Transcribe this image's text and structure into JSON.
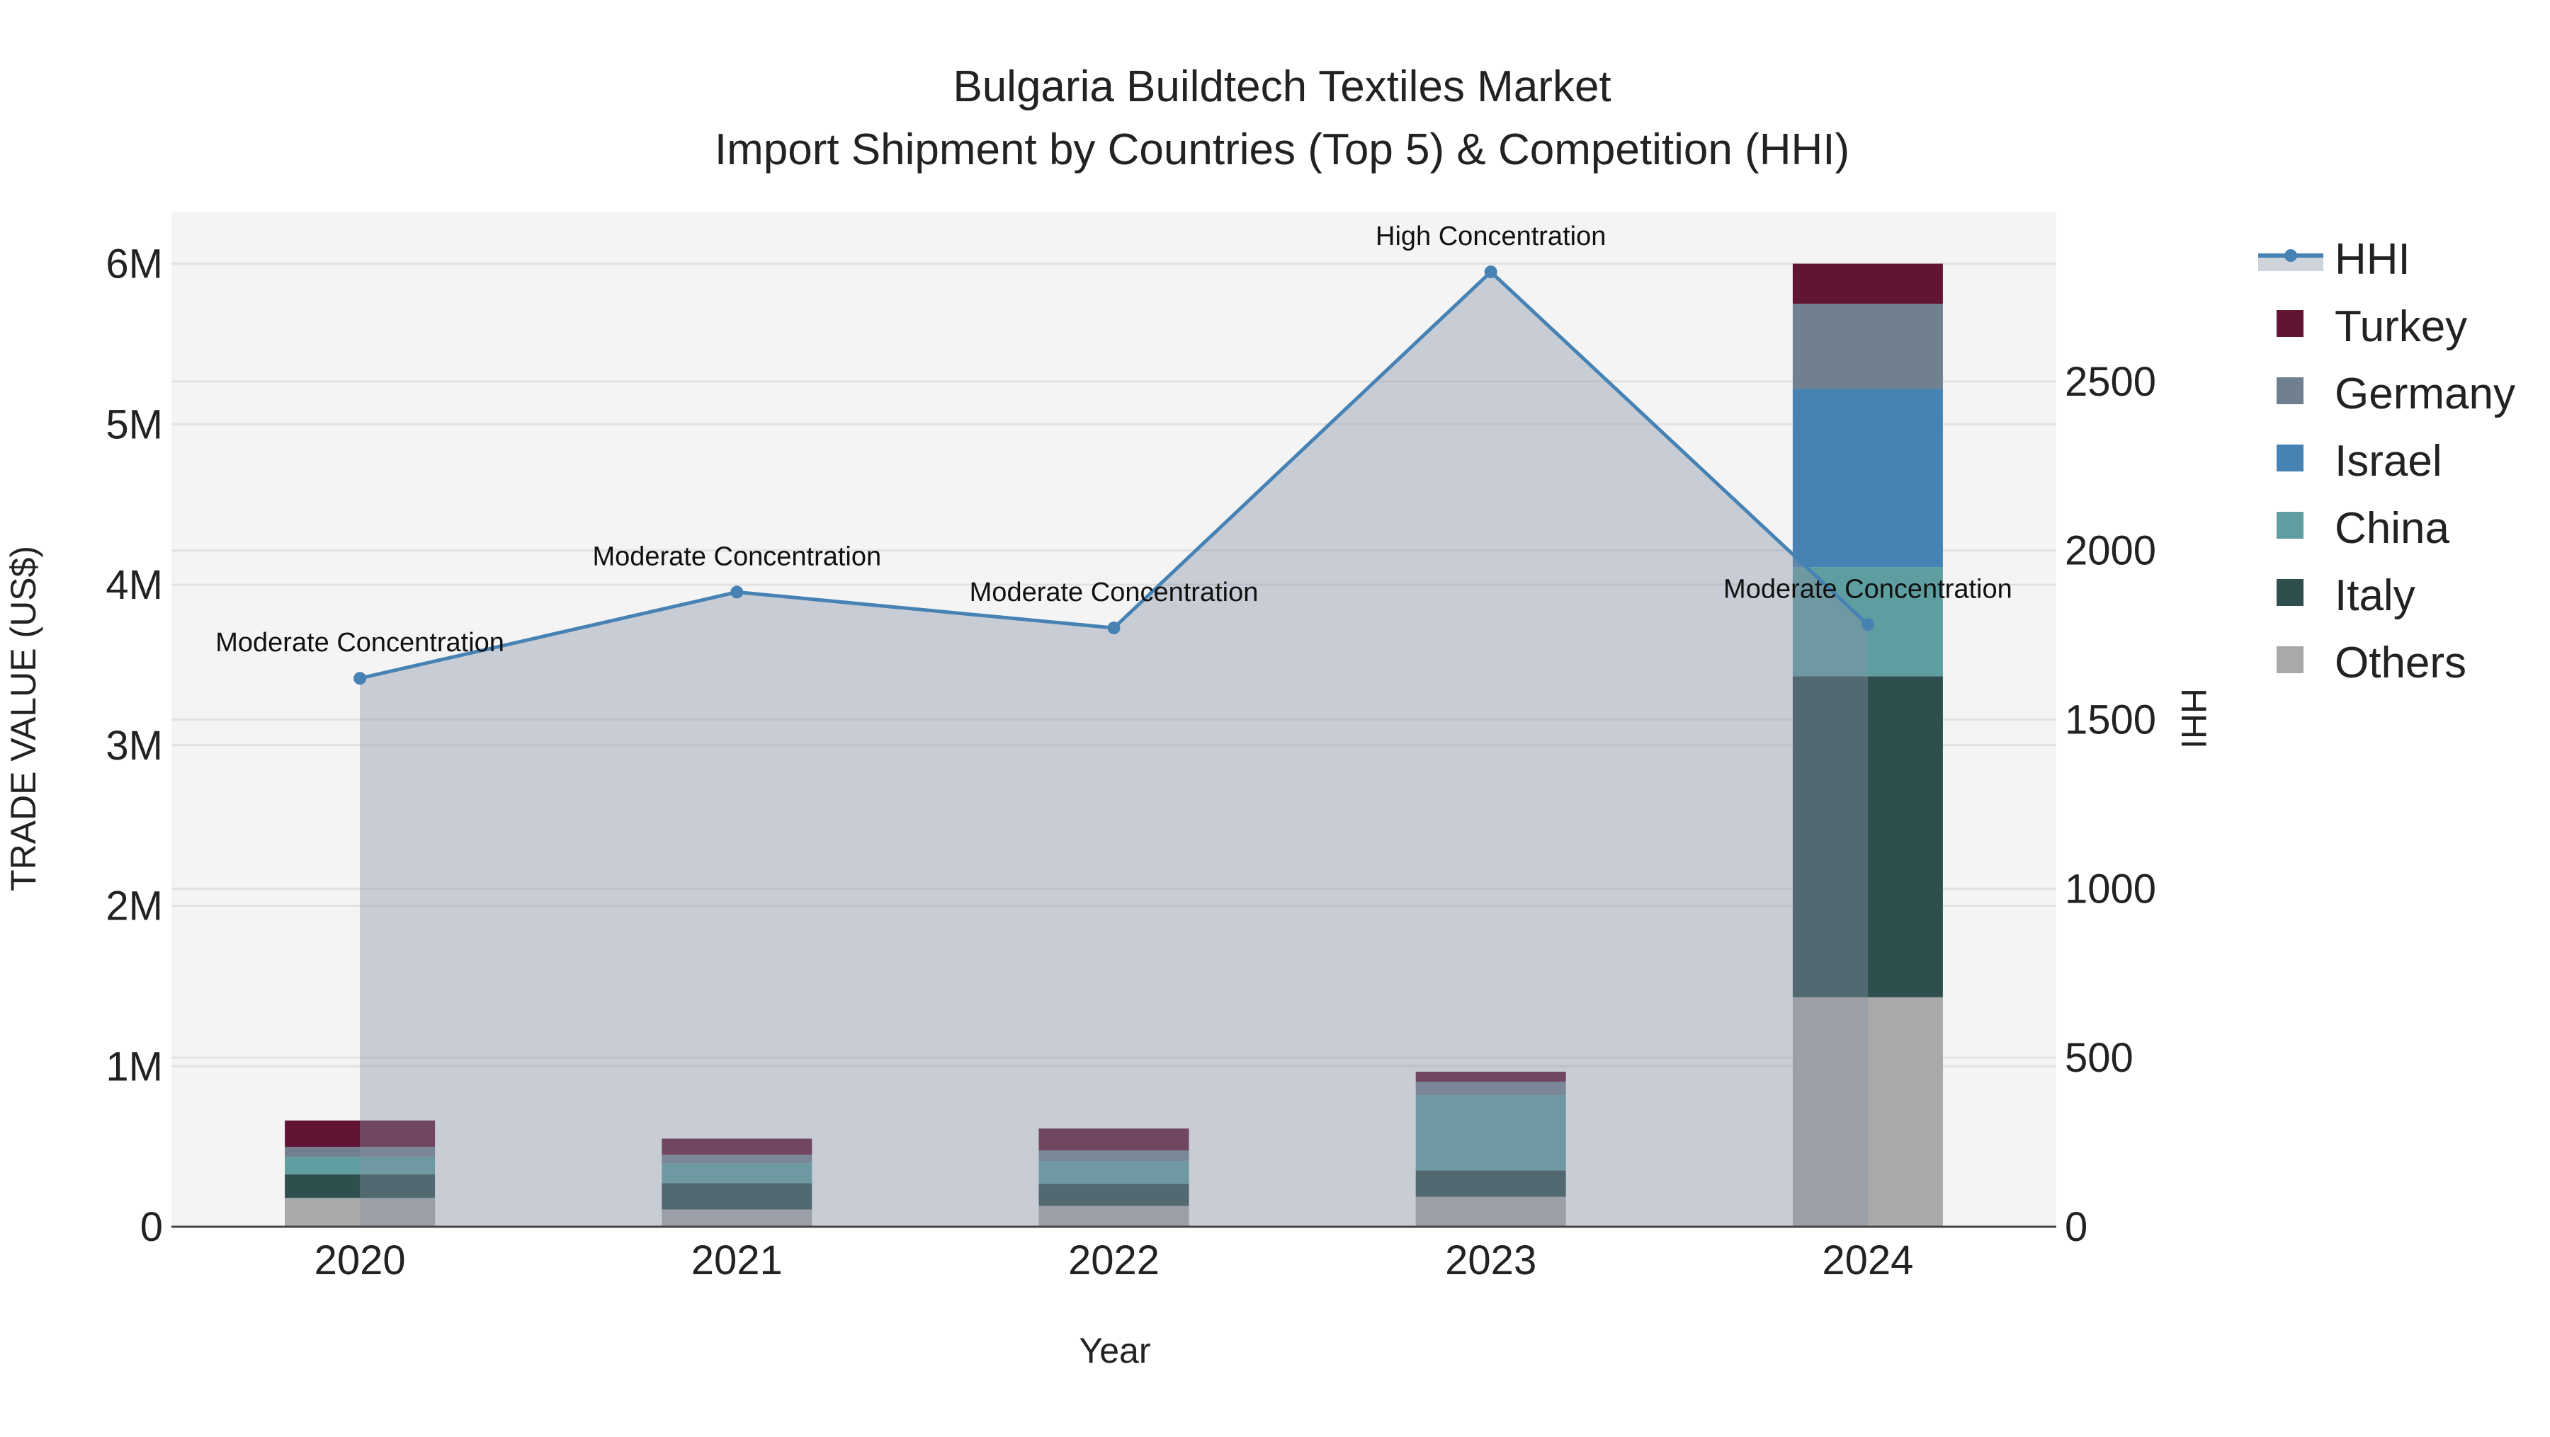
{
  "chart_data": {
    "type": "bar",
    "stacked": true,
    "title": "Bulgaria Buildtech Textiles Market",
    "subtitle": "Import Shipment by Countries (Top 5) & Competition (HHI)",
    "xlabel": "Year",
    "ylabel": "TRADE VALUE (US$)",
    "y2label": "HHI",
    "categories": [
      "2020",
      "2021",
      "2022",
      "2023",
      "2024"
    ],
    "ylim": [
      0,
      6320000
    ],
    "y2lim": [
      0,
      3000
    ],
    "yticks": [
      0,
      1000000,
      2000000,
      3000000,
      4000000,
      5000000,
      6000000
    ],
    "ytick_labels": [
      "0",
      "1M",
      "2M",
      "3M",
      "4M",
      "5M",
      "6M"
    ],
    "y2ticks": [
      0,
      500,
      1000,
      1500,
      2000,
      2500
    ],
    "y2tick_labels": [
      "0",
      "500",
      "1000",
      "1500",
      "2000",
      "2500"
    ],
    "grid": true,
    "legend_position": "right",
    "series": [
      {
        "name": "Others",
        "color": "#a9a9a9",
        "values": [
          180000,
          108000,
          130000,
          187000,
          1430000
        ]
      },
      {
        "name": "Italy",
        "color": "#2f4f4f",
        "values": [
          146000,
          164000,
          137000,
          164000,
          2000000
        ]
      },
      {
        "name": "China",
        "color": "#5f9ea0",
        "values": [
          110000,
          124000,
          142000,
          469000,
          680000
        ]
      },
      {
        "name": "Israel",
        "color": "#4682b4",
        "values": [
          0,
          0,
          0,
          0,
          1110000
        ]
      },
      {
        "name": "Germany",
        "color": "#708090",
        "values": [
          62000,
          53000,
          66000,
          84000,
          530000
        ]
      },
      {
        "name": "Turkey",
        "color": "#611434",
        "values": [
          164000,
          100000,
          137000,
          62000,
          250000
        ]
      }
    ],
    "hhi": {
      "name": "HHI",
      "color": "#4682b4",
      "values": [
        1622,
        1877,
        1771,
        2824,
        1781
      ],
      "annotations": [
        "Moderate Concentration",
        "Moderate Concentration",
        "Moderate Concentration",
        "High Concentration",
        "Moderate Concentration"
      ]
    },
    "legend_order": [
      "HHI",
      "Turkey",
      "Germany",
      "Israel",
      "China",
      "Italy",
      "Others"
    ]
  }
}
